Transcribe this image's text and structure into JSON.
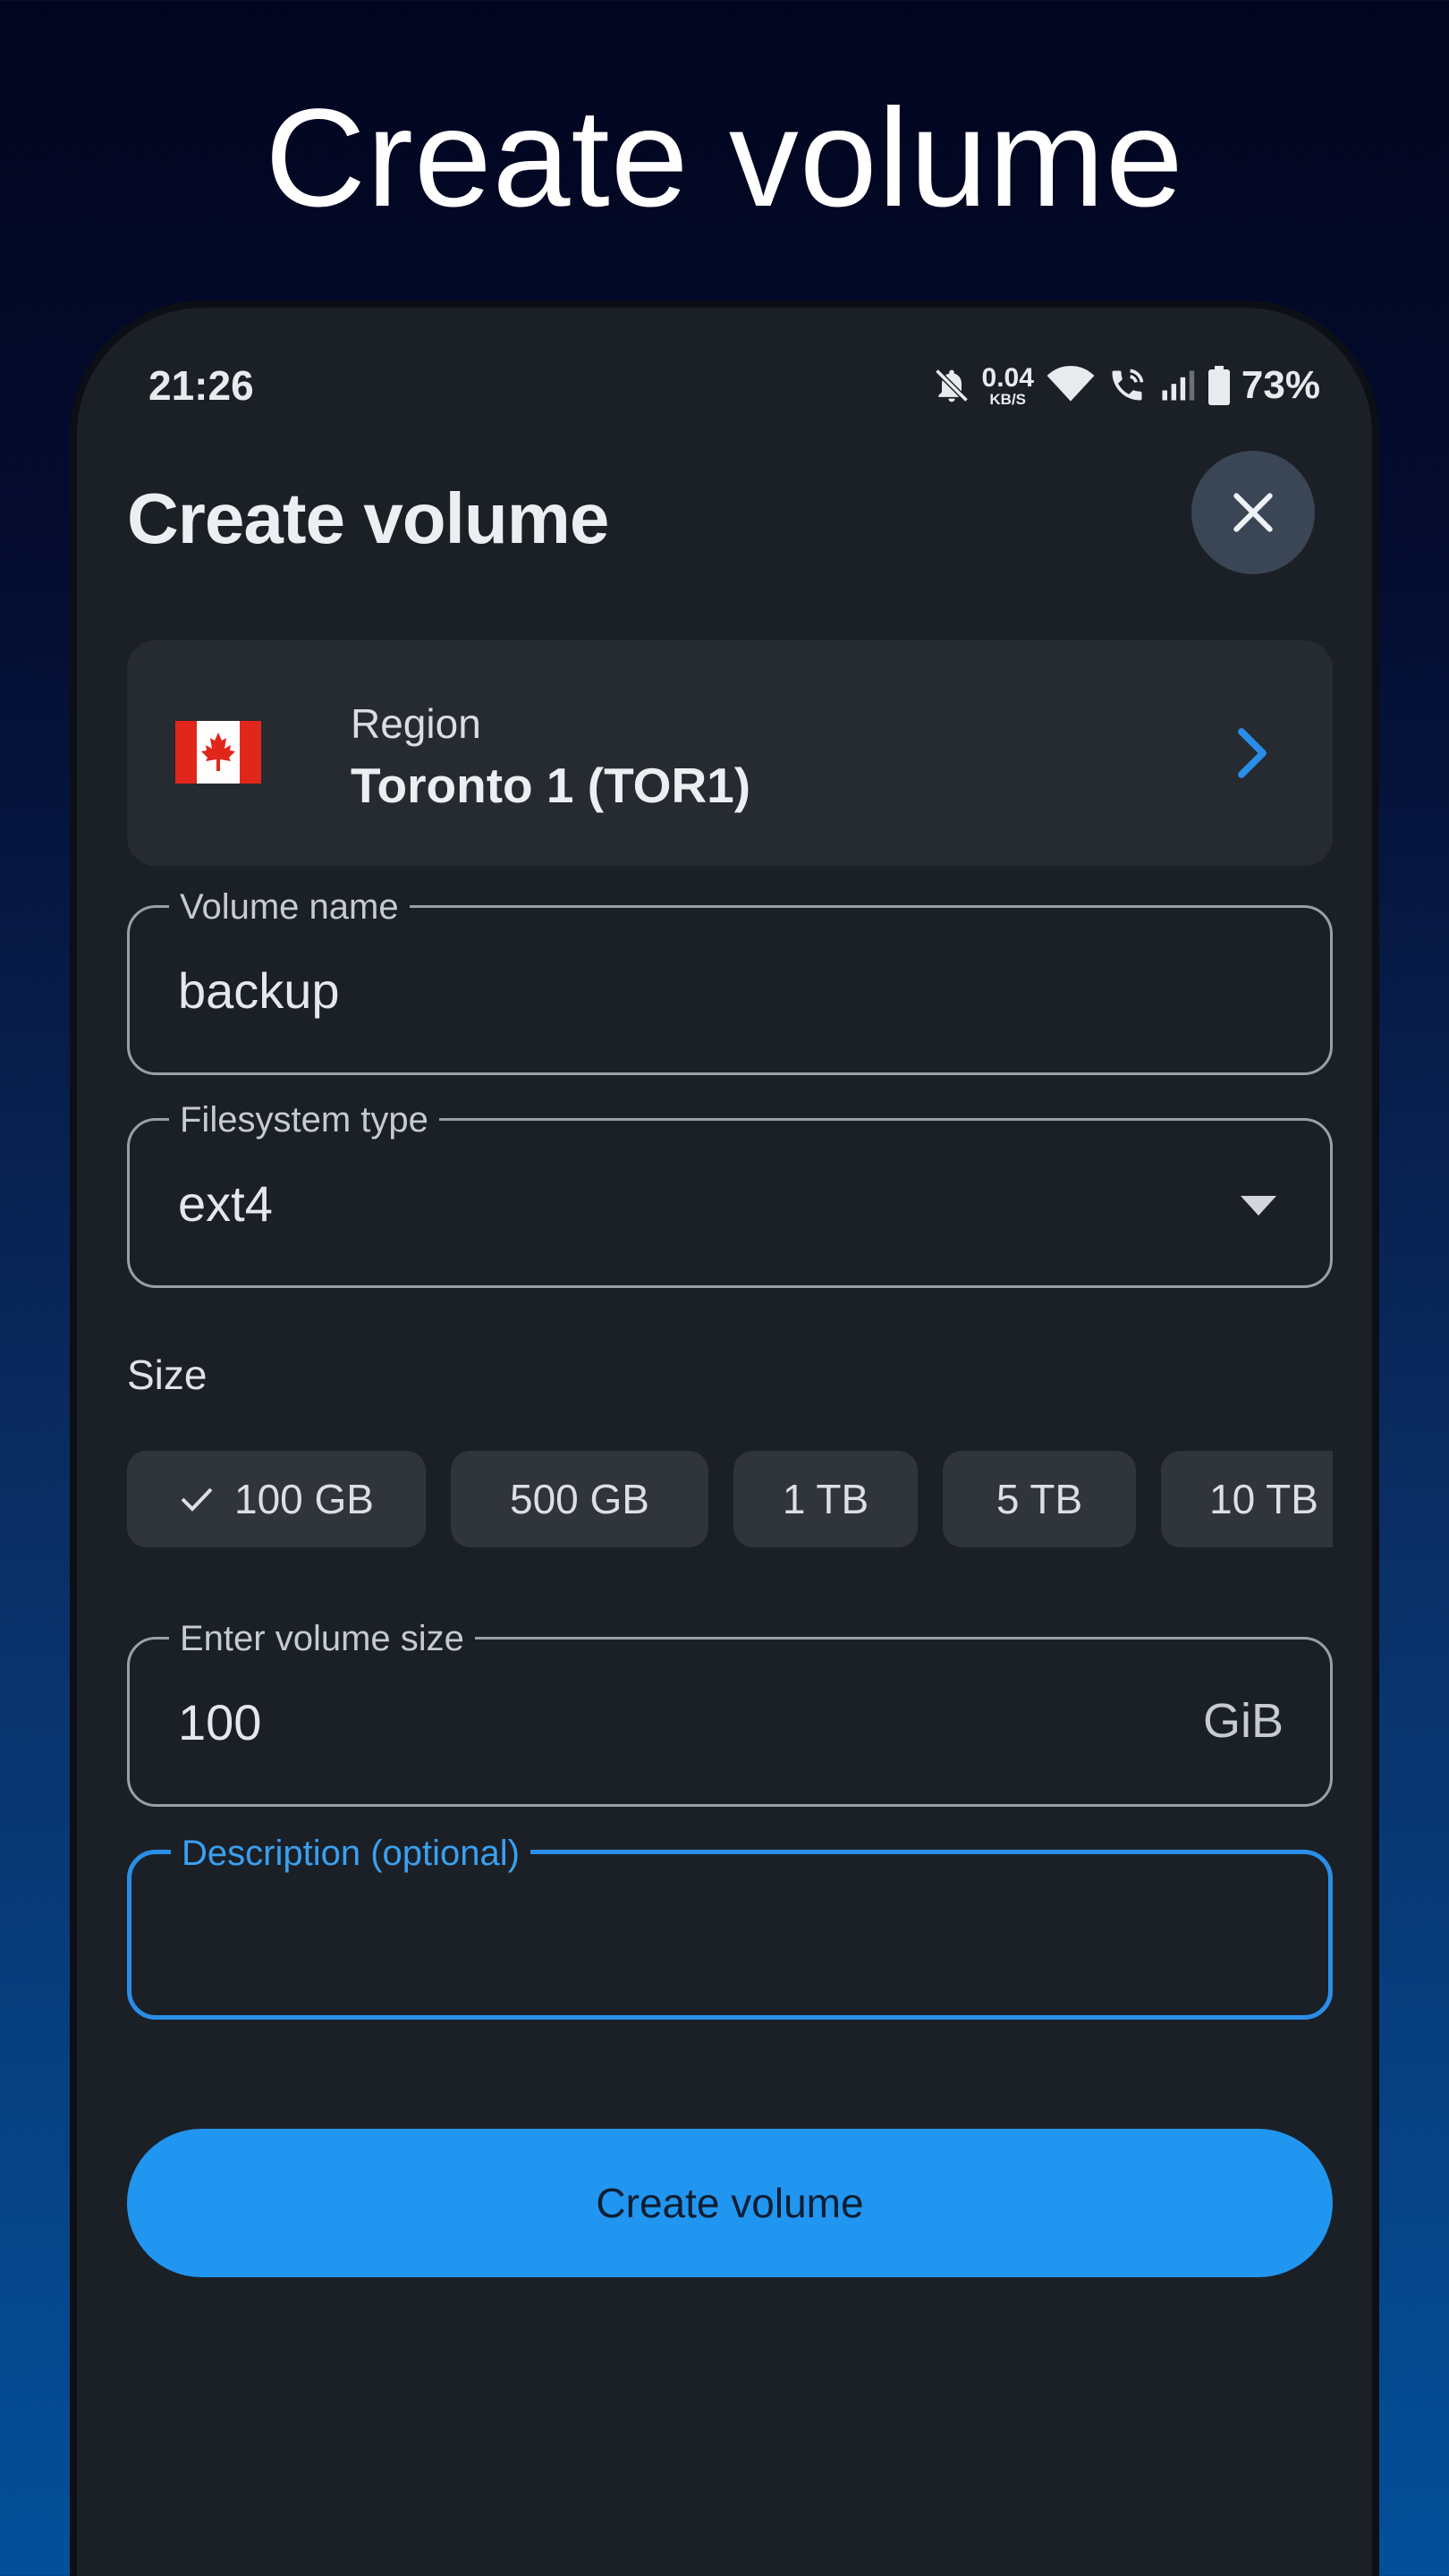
{
  "hero": {
    "title": "Create volume"
  },
  "status_bar": {
    "time": "21:26",
    "speed_value": "0.04",
    "speed_unit": "KB/S",
    "battery": "73%",
    "icons": [
      "bell-off-icon",
      "wifi-icon",
      "wifi-call-icon",
      "signal-icon",
      "battery-icon"
    ]
  },
  "header": {
    "title": "Create volume",
    "close_icon": "close-icon"
  },
  "region": {
    "label": "Region",
    "value": "Toronto 1 (TOR1)",
    "flag": "canada-flag-icon",
    "chevron": "chevron-right-icon"
  },
  "volume_name": {
    "label": "Volume name",
    "value": "backup"
  },
  "filesystem": {
    "label": "Filesystem type",
    "value": "ext4"
  },
  "size": {
    "label": "Size",
    "chips": [
      "100 GB",
      "500 GB",
      "1 TB",
      "5 TB",
      "10 TB"
    ],
    "selected": "100 GB"
  },
  "volume_size": {
    "label": "Enter volume size",
    "value": "100",
    "unit": "GiB"
  },
  "description": {
    "label": "Description (optional)",
    "value": ""
  },
  "submit": {
    "label": "Create volume"
  },
  "colors": {
    "accent": "#2196f0",
    "surface": "#1b2027",
    "card": "#262a31",
    "chip": "#30343b",
    "focus": "#2a8ee8"
  }
}
